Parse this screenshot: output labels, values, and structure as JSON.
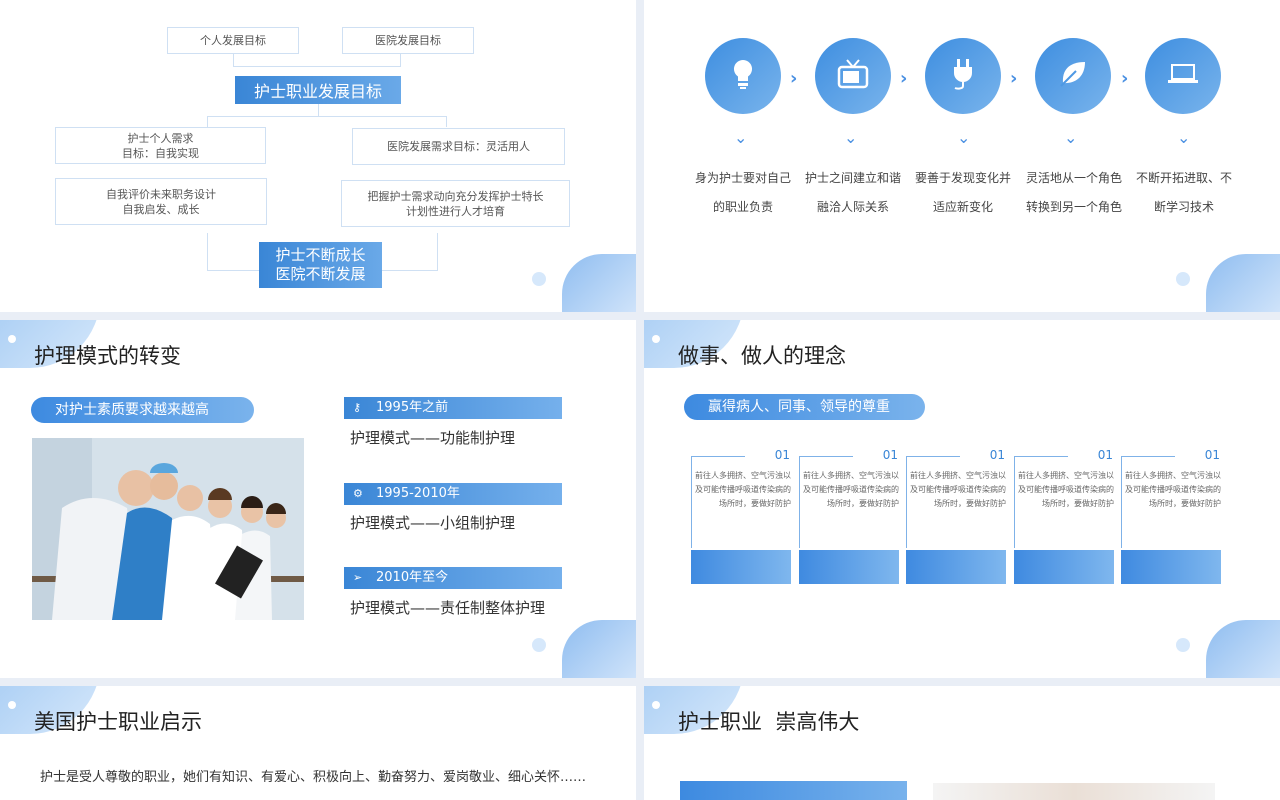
{
  "slide1": {
    "personal_goal": "个人发展目标",
    "hospital_goal": "医院发展目标",
    "career_goal": "护士职业发展目标",
    "nurse_need_l1": "护士个人需求",
    "nurse_need_l2": "目标：自我实现",
    "hospital_need": "医院发展需求目标：灵活用人",
    "self_eval_l1": "自我评价未来职务设计",
    "self_eval_l2": "自我启发、成长",
    "grasp_l1": "把握护士需求动向充分发挥护士特长",
    "grasp_l2": "计划性进行人才培育",
    "result_l1": "护士不断成长",
    "result_l2": "医院不断发展"
  },
  "slide2": {
    "steps": [
      {
        "icon": "lightbulb-icon",
        "line1": "身为护士要对自己",
        "line2": "的职业负责"
      },
      {
        "icon": "tv-icon",
        "line1": "护士之间建立和谐",
        "line2": "融洽人际关系"
      },
      {
        "icon": "plug-icon",
        "line1": "要善于发现变化并",
        "line2": "适应新变化"
      },
      {
        "icon": "leaf-icon",
        "line1": "灵活地从一个角色",
        "line2": "转换到另一个角色"
      },
      {
        "icon": "laptop-icon",
        "line1": "不断开拓进取、不",
        "line2": "断学习技术"
      }
    ]
  },
  "slide3": {
    "title": "护理模式的转变",
    "pill": "对护士素质要求越来越高",
    "eras": [
      {
        "icon": "key-icon",
        "period": "1995年之前",
        "mode": "护理模式——功能制护理"
      },
      {
        "icon": "gear-icon",
        "period": "1995-2010年",
        "mode": "护理模式——小组制护理"
      },
      {
        "icon": "paper-plane-icon",
        "period": "2010年至今",
        "mode": "护理模式——责任制整体护理"
      }
    ]
  },
  "slide4": {
    "title": "做事、做人的理念",
    "pill": "赢得病人、同事、领导的尊重",
    "columns": [
      {
        "num": "01",
        "l1": "前往人多拥挤、空气污浊以",
        "l2": "及可能传播呼吸道传染病的",
        "l3": "场所时，要做好防护"
      },
      {
        "num": "01",
        "l1": "前往人多拥挤、空气污浊以",
        "l2": "及可能传播呼吸道传染病的",
        "l3": "场所时，要做好防护"
      },
      {
        "num": "01",
        "l1": "前往人多拥挤、空气污浊以",
        "l2": "及可能传播呼吸道传染病的",
        "l3": "场所时，要做好防护"
      },
      {
        "num": "01",
        "l1": "前往人多拥挤、空气污浊以",
        "l2": "及可能传播呼吸道传染病的",
        "l3": "场所时，要做好防护"
      },
      {
        "num": "01",
        "l1": "前往人多拥挤、空气污浊以",
        "l2": "及可能传播呼吸道传染病的",
        "l3": "场所时，要做好防护"
      }
    ]
  },
  "slide5": {
    "title": "美国护士职业启示",
    "paragraph": "护士是受人尊敬的职业，她们有知识、有爱心、积极向上、勤奋努力、爱岗敬业、细心关怀……"
  },
  "slide6": {
    "title": "护士职业  崇高伟大"
  },
  "colors": {
    "accent": "#3a86d6",
    "accent_light": "#7ab3ec",
    "line": "#cfe0f3"
  }
}
